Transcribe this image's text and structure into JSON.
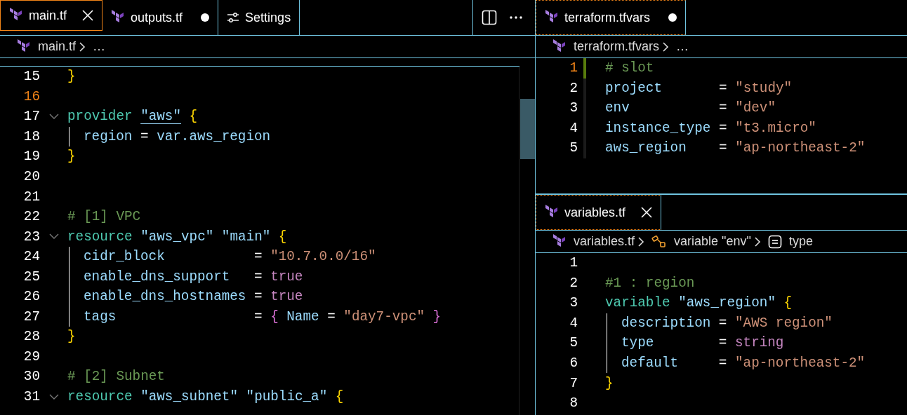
{
  "left_group": {
    "focused": true,
    "tabs": [
      {
        "label": "main.tf",
        "kind": "file",
        "selected": true,
        "dirty": false
      },
      {
        "label": "outputs.tf",
        "kind": "file",
        "selected": false,
        "dirty": true
      },
      {
        "label": "Settings",
        "kind": "settings",
        "selected": false,
        "dirty": false
      }
    ],
    "breadcrumb": [
      {
        "label": "main.tf",
        "kind": "file"
      },
      {
        "label": "…",
        "kind": "more"
      }
    ],
    "lines": [
      {
        "number": "15",
        "current": false,
        "fold": false,
        "guide": false,
        "tokens": [
          {
            "kind": "brace",
            "text": "}"
          }
        ]
      },
      {
        "number": "16",
        "current": true,
        "fold": false,
        "guide": false
      },
      {
        "number": "17",
        "current": false,
        "fold": true,
        "guide": false,
        "tokens": [
          {
            "kind": "kw",
            "text": "provider "
          },
          {
            "kind": "link",
            "text": "\"aws\""
          },
          {
            "kind": "brace",
            "text": " {"
          }
        ]
      },
      {
        "number": "18",
        "current": false,
        "fold": false,
        "guide": true,
        "tokens": [
          {
            "kind": "prop",
            "text": "region"
          },
          {
            "kind": "op",
            "text": " = "
          },
          {
            "kind": "prop",
            "text": "var.aws_region"
          }
        ]
      },
      {
        "number": "19",
        "current": false,
        "fold": false,
        "guide": false,
        "tokens": [
          {
            "kind": "brace",
            "text": "}"
          }
        ]
      },
      {
        "number": "20",
        "current": false,
        "fold": false,
        "guide": false
      },
      {
        "number": "21",
        "current": false,
        "fold": false,
        "guide": false
      },
      {
        "number": "22",
        "current": false,
        "fold": false,
        "guide": false,
        "tokens": [
          {
            "kind": "comment",
            "text": "# [1] VPC"
          }
        ]
      },
      {
        "number": "23",
        "current": false,
        "fold": true,
        "guide": false,
        "tokens": [
          {
            "kind": "kw",
            "text": "resource "
          },
          {
            "kind": "label",
            "text": "\"aws_vpc\" \"main\""
          },
          {
            "kind": "brace",
            "text": " {"
          }
        ]
      },
      {
        "number": "24",
        "current": false,
        "fold": false,
        "guide": true,
        "tokens": [
          {
            "kind": "prop",
            "text": "cidr_block"
          },
          {
            "kind": "op",
            "text": "           = "
          },
          {
            "kind": "str",
            "text": "\"10.7.0.0/16\""
          }
        ]
      },
      {
        "number": "25",
        "current": false,
        "fold": false,
        "guide": true,
        "tokens": [
          {
            "kind": "prop",
            "text": "enable_dns_support"
          },
          {
            "kind": "op",
            "text": "   = "
          },
          {
            "kind": "lit",
            "text": "true"
          }
        ]
      },
      {
        "number": "26",
        "current": false,
        "fold": false,
        "guide": true,
        "tokens": [
          {
            "kind": "prop",
            "text": "enable_dns_hostnames"
          },
          {
            "kind": "op",
            "text": " = "
          },
          {
            "kind": "lit",
            "text": "true"
          }
        ]
      },
      {
        "number": "27",
        "current": false,
        "fold": false,
        "guide": true,
        "tokens": [
          {
            "kind": "prop",
            "text": "tags"
          },
          {
            "kind": "op",
            "text": "                 = "
          },
          {
            "kind": "brace2",
            "text": "{ "
          },
          {
            "kind": "prop",
            "text": "Name"
          },
          {
            "kind": "op",
            "text": " = "
          },
          {
            "kind": "str",
            "text": "\"day7-vpc\""
          },
          {
            "kind": "brace2",
            "text": " }"
          }
        ]
      },
      {
        "number": "28",
        "current": false,
        "fold": false,
        "guide": false,
        "tokens": [
          {
            "kind": "brace",
            "text": "}"
          }
        ]
      },
      {
        "number": "29",
        "current": false,
        "fold": false,
        "guide": false
      },
      {
        "number": "30",
        "current": false,
        "fold": false,
        "guide": false,
        "tokens": [
          {
            "kind": "comment",
            "text": "# [2] Subnet"
          }
        ]
      },
      {
        "number": "31",
        "current": false,
        "fold": true,
        "guide": false,
        "tokens": [
          {
            "kind": "kw",
            "text": "resource "
          },
          {
            "kind": "label",
            "text": "\"aws_subnet\" \"public_a\""
          },
          {
            "kind": "brace",
            "text": " {"
          }
        ]
      }
    ]
  },
  "right_top": {
    "focused": false,
    "tabs": [
      {
        "label": "terraform.tfvars",
        "kind": "file",
        "selected": true,
        "dirty": true
      }
    ],
    "breadcrumb": [
      {
        "label": "terraform.tfvars",
        "kind": "file"
      },
      {
        "label": "…",
        "kind": "more"
      }
    ],
    "lines": [
      {
        "number": "1",
        "current": true,
        "fold": false,
        "guide": false,
        "modified": true,
        "tokens": [
          {
            "kind": "comment",
            "text": "# slot"
          }
        ]
      },
      {
        "number": "2",
        "current": false,
        "fold": false,
        "guide": false,
        "modified": false,
        "tokens": [
          {
            "kind": "prop",
            "text": "project"
          },
          {
            "kind": "op",
            "text": "       = "
          },
          {
            "kind": "str",
            "text": "\"study\""
          }
        ]
      },
      {
        "number": "3",
        "current": false,
        "fold": false,
        "guide": false,
        "modified": false,
        "tokens": [
          {
            "kind": "prop",
            "text": "env"
          },
          {
            "kind": "op",
            "text": "           = "
          },
          {
            "kind": "str",
            "text": "\"dev\""
          }
        ]
      },
      {
        "number": "4",
        "current": false,
        "fold": false,
        "guide": false,
        "modified": false,
        "tokens": [
          {
            "kind": "prop",
            "text": "instance_type"
          },
          {
            "kind": "op",
            "text": " = "
          },
          {
            "kind": "str",
            "text": "\"t3.micro\""
          }
        ]
      },
      {
        "number": "5",
        "current": false,
        "fold": false,
        "guide": false,
        "modified": false,
        "tokens": [
          {
            "kind": "prop",
            "text": "aws_region"
          },
          {
            "kind": "op",
            "text": "    = "
          },
          {
            "kind": "str",
            "text": "\"ap-northeast-2\""
          }
        ]
      }
    ]
  },
  "right_bottom": {
    "focused": false,
    "tabs": [
      {
        "label": "variables.tf",
        "kind": "file",
        "selected": true,
        "dirty": false
      }
    ],
    "breadcrumb": [
      {
        "label": "variables.tf",
        "kind": "file"
      },
      {
        "label": "variable \"env\"",
        "kind": "variable"
      },
      {
        "label": "type",
        "kind": "field"
      }
    ],
    "lines": [
      {
        "number": "1",
        "current": false,
        "fold": false,
        "guide": false
      },
      {
        "number": "2",
        "current": false,
        "fold": false,
        "guide": false,
        "tokens": [
          {
            "kind": "comment",
            "text": "#1 : region"
          }
        ]
      },
      {
        "number": "3",
        "current": false,
        "fold": false,
        "guide": false,
        "tokens": [
          {
            "kind": "kw",
            "text": "variable "
          },
          {
            "kind": "label",
            "text": "\"aws_region\""
          },
          {
            "kind": "brace",
            "text": " {"
          }
        ]
      },
      {
        "number": "4",
        "current": false,
        "fold": false,
        "guide": true,
        "tokens": [
          {
            "kind": "prop",
            "text": "description"
          },
          {
            "kind": "op",
            "text": " = "
          },
          {
            "kind": "str",
            "text": "\"AWS region\""
          }
        ]
      },
      {
        "number": "5",
        "current": false,
        "fold": false,
        "guide": true,
        "tokens": [
          {
            "kind": "prop",
            "text": "type"
          },
          {
            "kind": "op",
            "text": "        = "
          },
          {
            "kind": "lit",
            "text": "string"
          }
        ]
      },
      {
        "number": "6",
        "current": false,
        "fold": false,
        "guide": true,
        "tokens": [
          {
            "kind": "prop",
            "text": "default"
          },
          {
            "kind": "op",
            "text": "     = "
          },
          {
            "kind": "str",
            "text": "\"ap-northeast-2\""
          }
        ]
      },
      {
        "number": "7",
        "current": false,
        "fold": false,
        "guide": false,
        "tokens": [
          {
            "kind": "brace",
            "text": "}"
          }
        ]
      },
      {
        "number": "8",
        "current": false,
        "fold": false,
        "guide": false
      }
    ]
  }
}
